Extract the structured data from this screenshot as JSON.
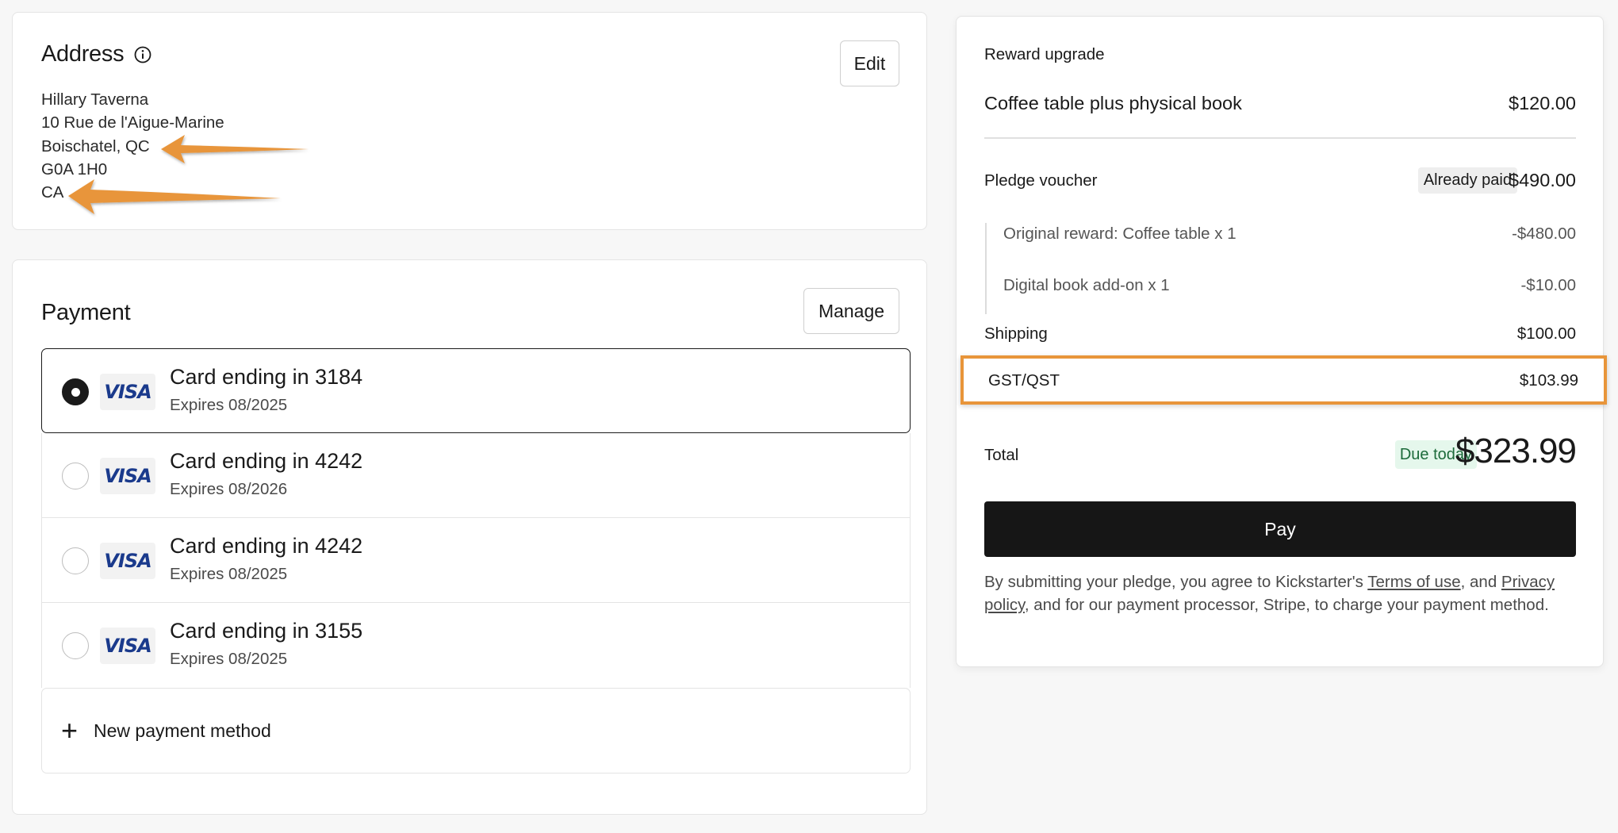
{
  "address": {
    "title": "Address",
    "edit_label": "Edit",
    "lines": [
      "Hillary Taverna",
      "10 Rue de l'Aigue-Marine",
      "Boischatel, QC",
      "G0A 1H0",
      "CA"
    ]
  },
  "payment": {
    "title": "Payment",
    "manage_label": "Manage",
    "cards": [
      {
        "brand": "VISA",
        "name": "Card ending in 3184",
        "expires": "Expires 08/2025",
        "selected": true
      },
      {
        "brand": "VISA",
        "name": "Card ending in 4242",
        "expires": "Expires 08/2026",
        "selected": false
      },
      {
        "brand": "VISA",
        "name": "Card ending in 4242",
        "expires": "Expires 08/2025",
        "selected": false
      },
      {
        "brand": "VISA",
        "name": "Card ending in 3155",
        "expires": "Expires 08/2025",
        "selected": false
      }
    ],
    "new_method_label": "New payment method"
  },
  "summary": {
    "reward_upgrade_label": "Reward upgrade",
    "reward_item": "Coffee table plus physical book",
    "reward_price": "$120.00",
    "pledge_label": "Pledge voucher",
    "pledge_badge": "Already paid",
    "pledge_amount": "$490.00",
    "sub_items": [
      {
        "label": "Original reward: Coffee table x 1",
        "amount": "-$480.00"
      },
      {
        "label": "Digital book add-on x 1",
        "amount": "-$10.00"
      }
    ],
    "shipping_label": "Shipping",
    "shipping_amount": "$100.00",
    "tax_label": "GST/QST",
    "tax_amount": "$103.99",
    "total_label": "Total",
    "total_badge": "Due today",
    "total_amount": "$323.99",
    "pay_label": "Pay",
    "legal": {
      "part1": "By submitting your pledge, you agree to Kickstarter's ",
      "terms_link": "Terms of use",
      "part2": ", and ",
      "privacy_link": "Privacy policy",
      "part3": ", and for our payment processor, Stripe, to charge your payment method."
    }
  },
  "colors": {
    "annotation_orange": "#e8953a",
    "pay_button": "#161616",
    "due_today_bg": "#e5f7ec",
    "visa_blue": "#1a3a8c"
  }
}
